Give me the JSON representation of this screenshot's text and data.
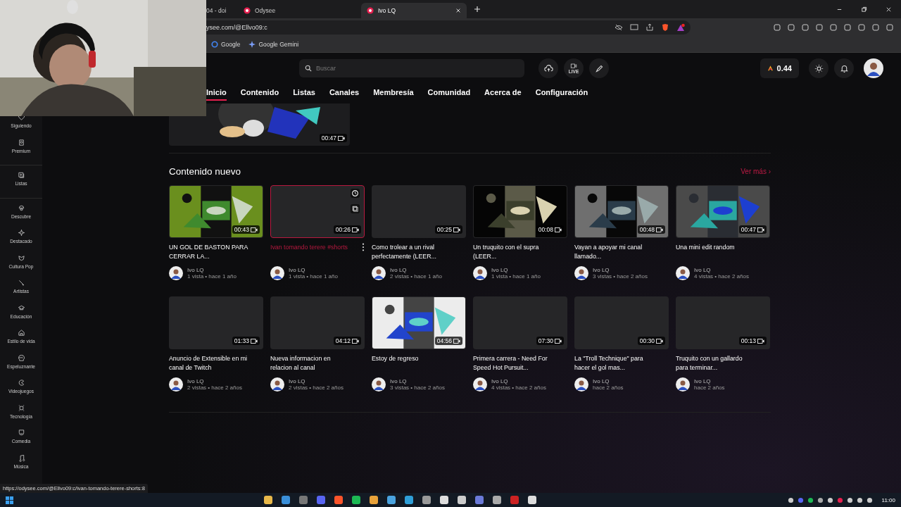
{
  "browser": {
    "tabs": [
      {
        "title": "04 - doi",
        "selected": false
      },
      {
        "title": "Odysee",
        "selected": false
      },
      {
        "title": "Ivo LQ",
        "selected": true
      }
    ],
    "address": "ysee.com/@Ellvo09:c",
    "bookmarks": [
      "Google",
      "Google Gemini"
    ]
  },
  "header": {
    "search": {
      "placeholder": "Buscar"
    },
    "live_label": "LIVE",
    "credits": "0.44"
  },
  "channel_nav": [
    {
      "label": "Inicio",
      "selected": true
    },
    {
      "label": "Contenido",
      "selected": false
    },
    {
      "label": "Listas",
      "selected": false
    },
    {
      "label": "Canales",
      "selected": false
    },
    {
      "label": "Membresía",
      "selected": false
    },
    {
      "label": "Comunidad",
      "selected": false
    },
    {
      "label": "Acerca de",
      "selected": false
    },
    {
      "label": "Configuración",
      "selected": false
    }
  ],
  "sidebar": {
    "items": [
      "Siguiendo",
      "Premium",
      "Listas",
      "Descubre",
      "Destacado",
      "Cultura Pop",
      "Artistas",
      "Educación",
      "Estilo de vida",
      "Espeluznante",
      "Videojuegos",
      "Tecnología",
      "Comedia",
      "Música"
    ]
  },
  "previous_video": {
    "kind": "picture",
    "duration": "00:47"
  },
  "section": {
    "title": "Contenido nuevo",
    "more_link": "Ver más ›",
    "videos": [
      {
        "kind": "picture",
        "duration": "00:43",
        "title": "UN GOL DE BASTON PARA CERRAR LA...",
        "channel": "Ivo LQ",
        "meta": "1 vista • hace 1 año",
        "hovered": false
      },
      {
        "duration": "00:26",
        "title": "Ivan tomando terere #shorts",
        "channel": "Ivo LQ",
        "meta": "1 vista • hace 1 año",
        "hovered": true
      },
      {
        "duration": "00:25",
        "title": "Como trolear a un rival perfectamente (LEER...",
        "channel": "Ivo LQ",
        "meta": "2 vistas • hace 1 año",
        "hovered": false
      },
      {
        "kind": "picture",
        "duration": "00:08",
        "title": "Un truquito con el supra (LEER...",
        "channel": "Ivo LQ",
        "meta": "1 vista • hace 1 año",
        "hovered": false
      },
      {
        "kind": "picture",
        "duration": "00:48",
        "title": "Vayan a apoyar mi canal llamado...",
        "channel": "Ivo LQ",
        "meta": "3 vistas • hace 2 años",
        "hovered": false
      },
      {
        "kind": "picture",
        "duration": "00:47",
        "title": "Una mini edit random",
        "channel": "Ivo LQ",
        "meta": "4 vistas • hace 2 años",
        "hovered": false
      },
      {
        "duration": "01:33",
        "title": "Anuncio de Extensible en mi canal de Twitch",
        "channel": "Ivo LQ",
        "meta": "2 vistas • hace 2 años",
        "hovered": false
      },
      {
        "duration": "04:12",
        "title": "Nueva informacion en relacion al canal",
        "channel": "Ivo LQ",
        "meta": "2 vistas • hace 2 años",
        "hovered": false
      },
      {
        "kind": "picture",
        "duration": "04:56",
        "title": "Estoy de regreso",
        "channel": "Ivo LQ",
        "meta": "3 vistas • hace 2 años",
        "hovered": false
      },
      {
        "duration": "07:30",
        "title": "Primera carrera - Need For Speed Hot Pursuit...",
        "channel": "Ivo LQ",
        "meta": "4 vistas • hace 2 años",
        "hovered": false
      },
      {
        "duration": "00:30",
        "title": "La \"Troll Technique\" para hacer el gol mas...",
        "channel": "Ivo LQ",
        "meta": "hace 2 años",
        "hovered": false
      },
      {
        "duration": "00:13",
        "title": "Truquito con un gallardo para terminar...",
        "channel": "Ivo LQ",
        "meta": "hace 2 años",
        "hovered": false
      }
    ]
  },
  "status_url": "https://odysee.com/@Ellvo09:c/ivan-tomando-terere-shorts:8",
  "taskbar": {
    "time": "11:00"
  }
}
